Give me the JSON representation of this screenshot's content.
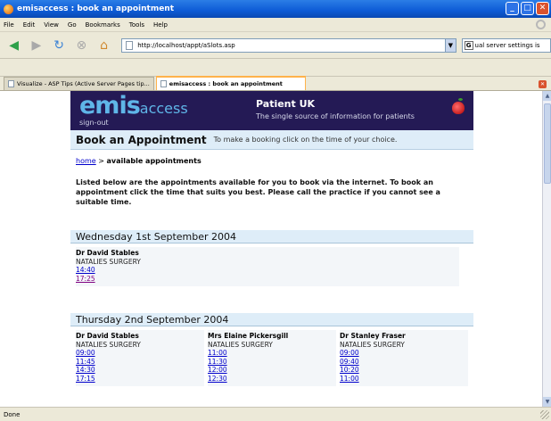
{
  "window": {
    "title": "emisaccess : book an appointment"
  },
  "menu": [
    "File",
    "Edit",
    "View",
    "Go",
    "Bookmarks",
    "Tools",
    "Help"
  ],
  "address": {
    "url": "http://localhost/appt/aSlots.asp",
    "search_text": "ual server settings is"
  },
  "tabs": [
    {
      "label": "Visualize - ASP Tips (Active Server Pages tip..."
    },
    {
      "label": "emisaccess : book an appointment"
    }
  ],
  "status": "Done",
  "site": {
    "logo": "emis",
    "logo_suffix": "access",
    "signout": "sign-out",
    "name": "Patient UK",
    "tagline": "The single source of information for patients"
  },
  "heading": {
    "title": "Book an Appointment",
    "subtitle": "To make a booking click on the time of your choice."
  },
  "breadcrumb": {
    "home": "home",
    "separator": " > ",
    "current": "available appointments"
  },
  "intro": "Listed below are the appointments available for you to book via the internet. To book an appointment click the time that suits you best. Please call the practice if you cannot see a suitable time.",
  "days": [
    {
      "date": "Wednesday 1st September 2004",
      "clinicians": [
        {
          "name": "Dr David Stables",
          "surgery": "NATALIES SURGERY",
          "slots": [
            "14:40",
            "17:25"
          ]
        }
      ]
    },
    {
      "date": "Thursday 2nd September 2004",
      "clinicians": [
        {
          "name": "Dr David Stables",
          "surgery": "NATALIES SURGERY",
          "slots": [
            "09:00",
            "11:45",
            "14:30",
            "17:15"
          ]
        },
        {
          "name": "Mrs Elaine Pickersgill",
          "surgery": "NATALIES SURGERY",
          "slots": [
            "11:00",
            "11:30",
            "12:00",
            "12:30"
          ]
        },
        {
          "name": "Dr Stanley Fraser",
          "surgery": "NATALIES SURGERY",
          "slots": [
            "09:00",
            "09:40",
            "10:20",
            "11:00"
          ]
        }
      ]
    }
  ]
}
